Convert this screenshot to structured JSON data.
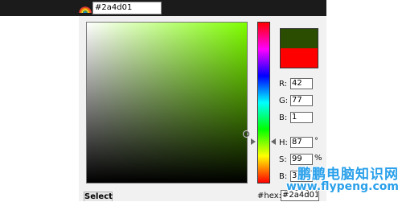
{
  "toolbar": {
    "icon": "rainbow-icon",
    "color_value": "#2a4d01"
  },
  "picker": {
    "base_hue_color": "#7fff00",
    "new_color": "#2a4d01",
    "old_color": "#ff0000",
    "fields": {
      "r_label": "R:",
      "r_value": "42",
      "g_label": "G:",
      "g_value": "77",
      "b_label": "B:",
      "b_value": "1",
      "h_label": "H:",
      "h_value": "87",
      "h_unit": "°",
      "s_label": "S:",
      "s_value": "99",
      "s_unit": "%",
      "v_label": "B:",
      "v_value": "30"
    },
    "hex_label": "#hex:",
    "hex_value": "#2a4d01",
    "select_label": "Select"
  },
  "watermark": {
    "title": "鹏鹏电脑知识网",
    "url": "www.flypeng.com",
    "color": "#2aa0ea"
  }
}
